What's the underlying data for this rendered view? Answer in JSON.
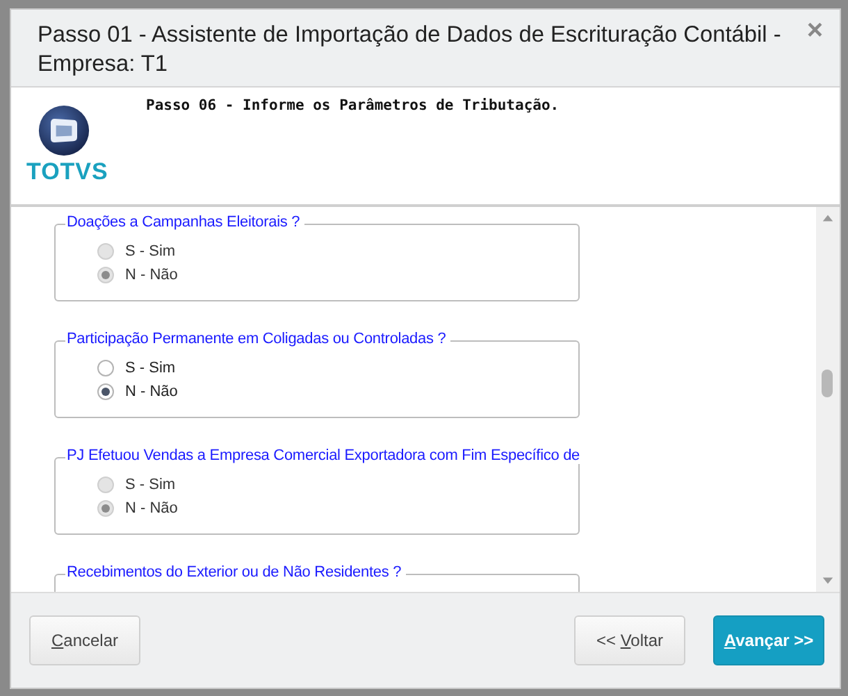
{
  "dialog": {
    "title": "Passo 01 - Assistente de Importação de Dados de Escrituração Contábil - Empresa: T1",
    "close": "×"
  },
  "header": {
    "logo_text": "TOTVS",
    "step": "Passo 06 - Informe os Parâmetros de Tributação."
  },
  "groups": [
    {
      "legend": "Doações a Campanhas Eleitorais ?",
      "disabled": true,
      "options": [
        {
          "label": "S - Sim",
          "selected": false
        },
        {
          "label": "N - Não",
          "selected": true
        }
      ]
    },
    {
      "legend": "Participação Permanente em Coligadas ou Controladas ?",
      "disabled": false,
      "options": [
        {
          "label": "S - Sim",
          "selected": false
        },
        {
          "label": "N - Não",
          "selected": true
        }
      ]
    },
    {
      "legend": "PJ Efetuou Vendas a Empresa Comercial Exportadora com Fim Específico de",
      "disabled": true,
      "options": [
        {
          "label": "S - Sim",
          "selected": false
        },
        {
          "label": "N - Não",
          "selected": true
        }
      ]
    },
    {
      "legend": "Recebimentos do Exterior ou de Não Residentes ?"
    }
  ],
  "buttons": [
    {
      "kind": "default",
      "mnemonic": "C",
      "after": "ancelar"
    },
    {
      "kind": "default",
      "before": "<< ",
      "mnemonic": "V",
      "after": "oltar"
    },
    {
      "kind": "primary",
      "mnemonic": "A",
      "after": "vançar >>"
    }
  ]
}
